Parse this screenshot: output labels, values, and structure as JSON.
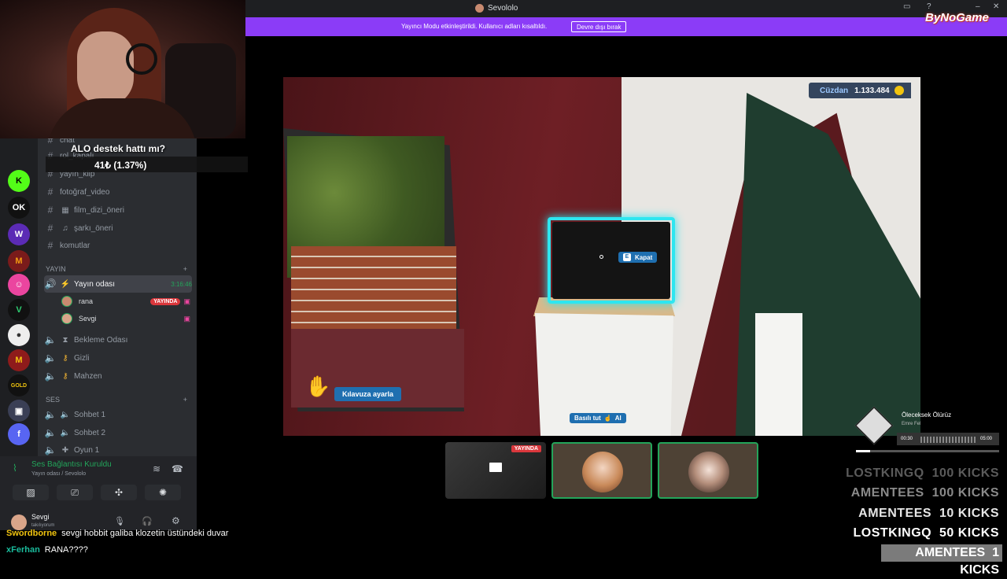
{
  "window": {
    "title": "Sevololo",
    "logo": "ByNoGame"
  },
  "streamer_mode": {
    "message": "Yayıncı Modu etkinleştirildi. Kullanıcı adları kısaltıldı.",
    "button": "Devre dışı bırak"
  },
  "poll": {
    "question": "ALO destek hattı mı?",
    "result": "41₺ (1.37%)"
  },
  "channels": [
    {
      "name": "chat",
      "icon": "hash-icon"
    },
    {
      "name": "rol_kapalı",
      "icon": "hash-icon"
    },
    {
      "name": "yayın_klip",
      "icon": "hash-icon"
    },
    {
      "name": "fotoğraf_video",
      "icon": "hash-icon"
    },
    {
      "name": "film_dizi_öneri",
      "icon": "hash-icon"
    },
    {
      "name": "şarkı_öneri",
      "icon": "hash-icon"
    },
    {
      "name": "komutlar",
      "icon": "hash-icon"
    }
  ],
  "categories": {
    "yayin": "YAYIN",
    "ses": "SES"
  },
  "voice_channels": {
    "yayin_odasi": {
      "name": "Yayın odası",
      "timer": "3:16:46"
    },
    "users": [
      {
        "name": "rana",
        "badge": "YAYINDA"
      },
      {
        "name": "Sevgi",
        "badge": ""
      }
    ],
    "others": [
      "Bekleme Odası",
      "Gizli",
      "Mahzen"
    ],
    "ses": [
      "Sohbet 1",
      "Sohbet 2",
      "Oyun 1"
    ]
  },
  "voice_panel": {
    "status": "Ses Bağlantısı Kuruldu",
    "location": "Yayın odası / Sevololo"
  },
  "user": {
    "name": "Sevgi",
    "status": "takılıyorum"
  },
  "chat": [
    {
      "user": "Swordborne",
      "text": "sevgi hobbit galiba klozetin üstündeki duvar"
    },
    {
      "user": "xFerhan",
      "text": "RANA????"
    }
  ],
  "game": {
    "wallet_label": "Cüzdan",
    "wallet_value": "1.133.484",
    "tv_action_key": "E",
    "tv_action": "Kapat",
    "guide": "Kılavuza ayarla",
    "hold_label": "Basılı tut",
    "hold_action": "Al"
  },
  "participants": {
    "live_badge": "YAYINDA"
  },
  "music": {
    "title": "Öleceksek Ölürüz",
    "artist": "Emre Fel",
    "elapsed": "00:30",
    "duration": "05:00",
    "progress": 0.1
  },
  "kicks": [
    {
      "user": "LOSTKINGQ",
      "amount": "100 KICKS"
    },
    {
      "user": "AMENTEES",
      "amount": "100 KICKS"
    },
    {
      "user": "AMENTEES",
      "amount": "10 KICKS"
    },
    {
      "user": "LOSTKINGQ",
      "amount": "50 KICKS"
    },
    {
      "user": "AMENTEES",
      "amount": "1 KICKS"
    }
  ]
}
